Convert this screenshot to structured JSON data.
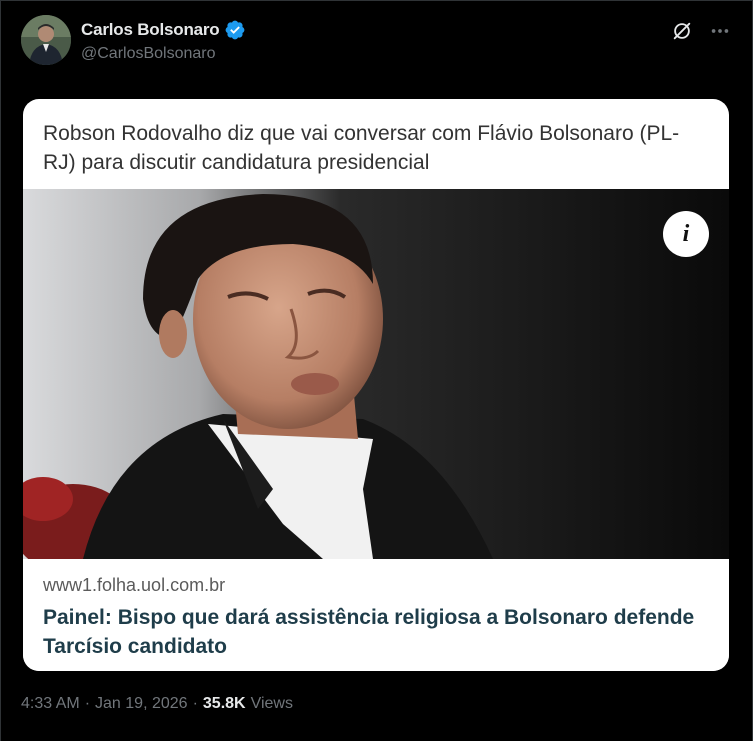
{
  "author": {
    "display_name": "Carlos Bolsonaro",
    "handle": "@CarlosBolsonaro",
    "verified": true,
    "verified_color": "#1d9bf0"
  },
  "actions": {
    "grok_icon": "grok-icon",
    "more_icon": "more-icon"
  },
  "card": {
    "headline": "Robson Rodovalho diz que vai conversar com Flávio Bolsonaro (PL-RJ) para discutir candidatura presidencial",
    "info_label": "i",
    "domain": "www1.folha.uol.com.br",
    "title": "Painel: Bispo que dará assistência religiosa a Bolsonaro defende Tarcísio candidato"
  },
  "meta": {
    "time": "4:33 AM",
    "separator": "·",
    "date": "Jan 19, 2026",
    "views_count": "35.8K",
    "views_label": "Views"
  }
}
